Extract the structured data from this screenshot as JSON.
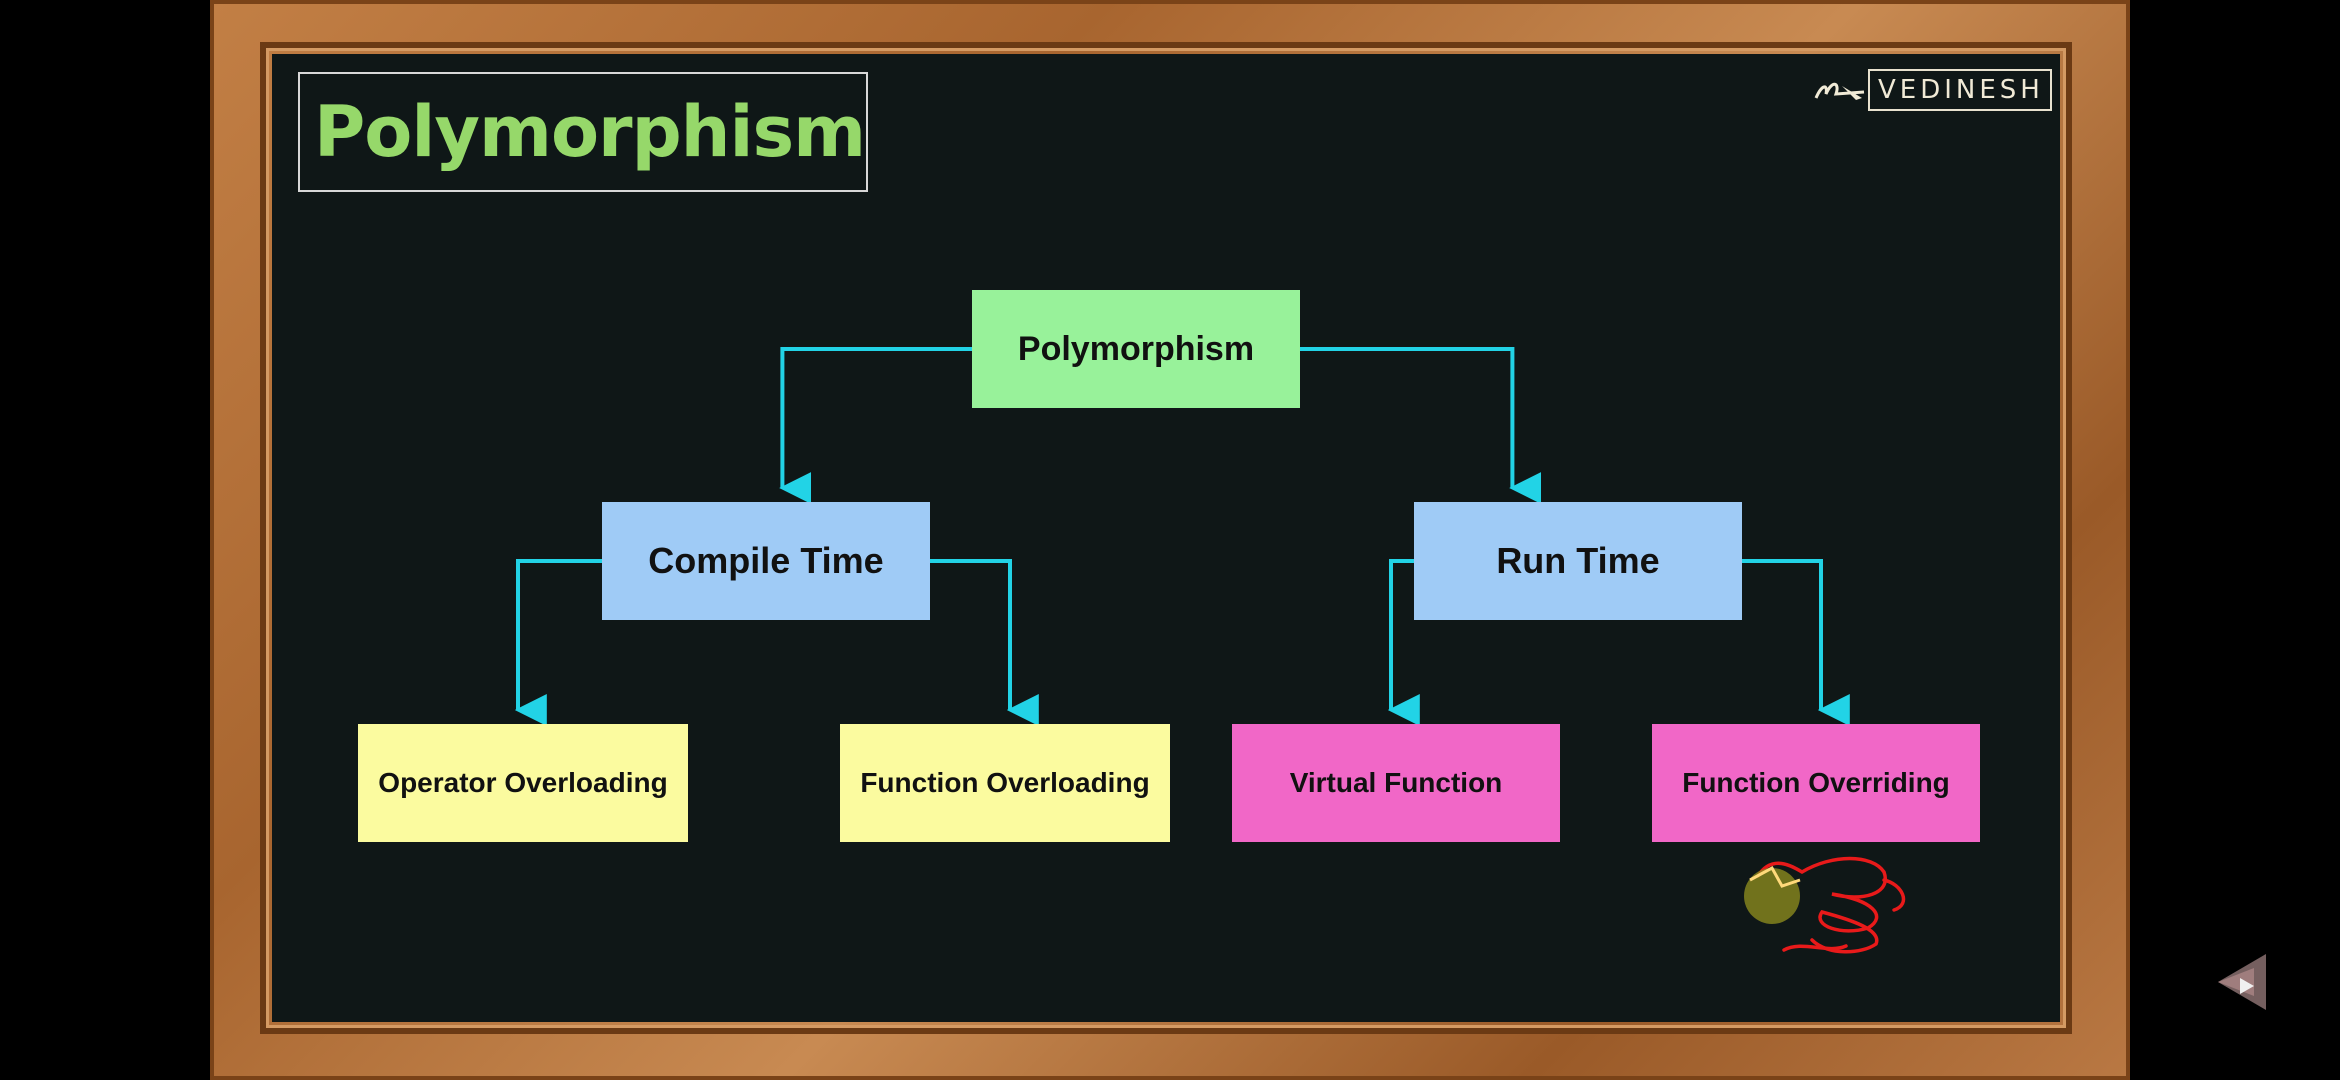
{
  "slide": {
    "title": "Polymorphism",
    "logo_text": "VEDINESH"
  },
  "diagram": {
    "root": {
      "label": "Polymorphism",
      "color": "#98f29a"
    },
    "branches": [
      {
        "label": "Compile Time",
        "color": "#9fcbf6",
        "children": [
          {
            "label": "Operator Overloading",
            "color": "#fbfb9f"
          },
          {
            "label": "Function Overloading",
            "color": "#fbfb9f"
          }
        ]
      },
      {
        "label": "Run Time",
        "color": "#9fcbf6",
        "children": [
          {
            "label": "Virtual Function",
            "color": "#f167c7"
          },
          {
            "label": "Function Overriding",
            "color": "#f167c7"
          }
        ]
      }
    ],
    "connector_color": "#22d3e6",
    "annotation_color": "#e81a1a"
  },
  "colors": {
    "board": "#0f1717",
    "frame": "#b97843",
    "title": "#96d86a"
  },
  "icons": {
    "logo": "pen-logo-icon",
    "media": "media-control-icon"
  }
}
